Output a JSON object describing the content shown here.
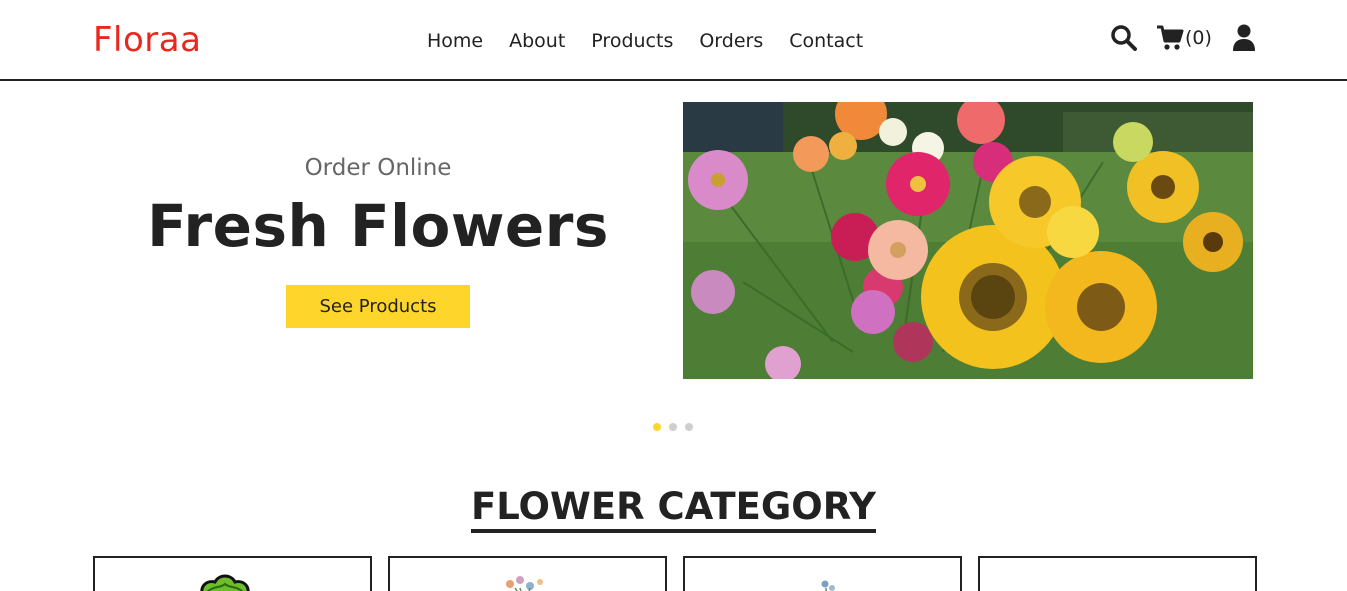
{
  "brand": {
    "name": "Floraa",
    "color": "#e8281e"
  },
  "nav": {
    "items": [
      {
        "label": "Home"
      },
      {
        "label": "About"
      },
      {
        "label": "Products"
      },
      {
        "label": "Orders"
      },
      {
        "label": "Contact"
      }
    ]
  },
  "header_icons": {
    "search": "search-icon",
    "cart": "cart-icon",
    "cart_count": "(0)",
    "user": "user-icon"
  },
  "hero": {
    "subtitle": "Order Online",
    "title": "Fresh Flowers",
    "cta_label": "See Products",
    "cta_color": "#fdd52b",
    "image": "flower-bouquet-image"
  },
  "carousel": {
    "slides": 3,
    "active_index": 0
  },
  "category_section": {
    "title": "FLOWER CATEGORY",
    "cards": [
      {
        "image": "category-image-1"
      },
      {
        "image": "category-image-2"
      },
      {
        "image": "category-image-3"
      },
      {
        "image": "category-image-4"
      }
    ]
  }
}
